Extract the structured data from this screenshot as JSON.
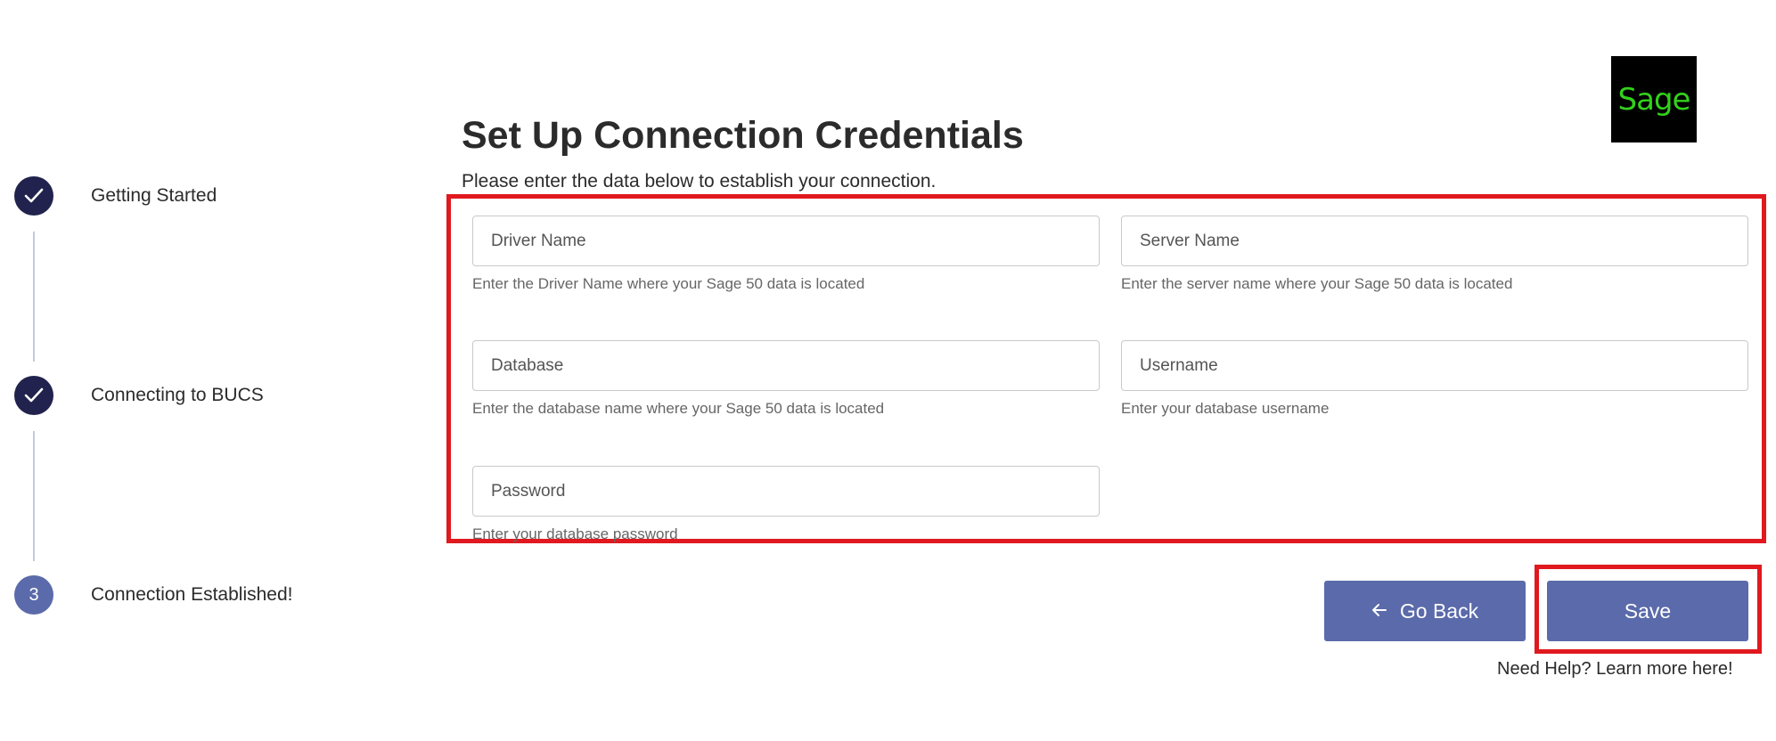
{
  "stepper": {
    "steps": [
      {
        "label": "Getting Started",
        "status": "done",
        "icon": "check-icon"
      },
      {
        "label": "Connecting to BUCS",
        "status": "done",
        "icon": "check-icon"
      },
      {
        "label": "Connection Established!",
        "status": "current",
        "number": "3"
      }
    ]
  },
  "header": {
    "title": "Set Up Connection Credentials",
    "subtitle": "Please enter the data below to establish your connection."
  },
  "logo": {
    "text": "Sage"
  },
  "form": {
    "driver_name": {
      "placeholder": "Driver Name",
      "value": "",
      "hint": "Enter the Driver Name where your Sage 50 data is located"
    },
    "server_name": {
      "placeholder": "Server Name",
      "value": "",
      "hint": "Enter the server name where your Sage 50 data is located"
    },
    "database": {
      "placeholder": "Database",
      "value": "",
      "hint": "Enter the database name where your Sage 50 data is located"
    },
    "username": {
      "placeholder": "Username",
      "value": "",
      "hint": "Enter your database username"
    },
    "password": {
      "placeholder": "Password",
      "value": "",
      "hint": "Enter your database password"
    }
  },
  "actions": {
    "go_back_label": "Go Back",
    "go_back_icon": "arrow-left-icon",
    "save_label": "Save",
    "help_text": "Need Help? Learn more here!"
  },
  "colors": {
    "primary": "#5b6aaa",
    "step_done": "#22224e",
    "highlight": "#e0191f",
    "logo_green": "#33d11b"
  }
}
